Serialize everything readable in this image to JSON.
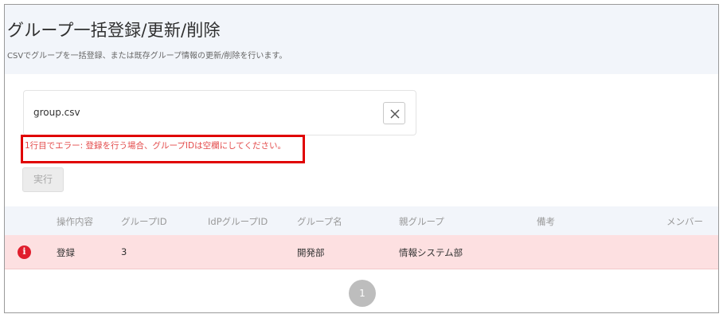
{
  "header": {
    "title": "グループ一括登録/更新/削除",
    "subtitle": "CSVでグループを一括登録、または既存グループ情報の更新/削除を行います。"
  },
  "upload": {
    "filename": "group.csv",
    "clear_icon": "close-icon"
  },
  "error": {
    "message": "1行目でエラー: 登録を行う場合、グループIDは空欄にしてください。",
    "highlight_color": "#e00000",
    "text_color": "#e34a4a"
  },
  "actions": {
    "execute_label": "実行"
  },
  "table": {
    "columns": [
      "操作内容",
      "グループID",
      "IdPグループID",
      "グループ名",
      "親グループ",
      "備考",
      "メンバー"
    ],
    "rows": [
      {
        "status_icon": "error-icon",
        "operation": "登録",
        "group_id": "3",
        "idp_group_id": "",
        "group_name": "開発部",
        "parent_group": "情報システム部",
        "note": "",
        "members": ""
      }
    ],
    "row_error_color": "#fde0e1"
  },
  "pagination": {
    "current_page": "1"
  }
}
